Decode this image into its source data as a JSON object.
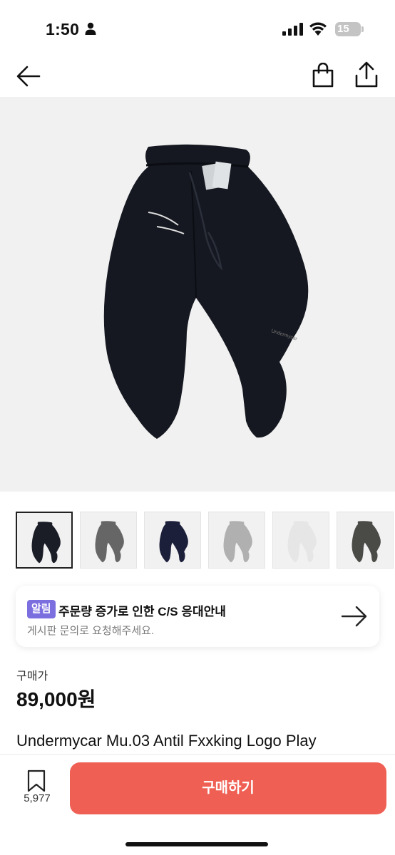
{
  "status_bar": {
    "time": "1:50",
    "battery": "15",
    "icons": [
      "person-icon",
      "signal-icon",
      "wifi-icon",
      "battery-icon"
    ]
  },
  "nav": {
    "icons": [
      "back-arrow-icon",
      "shopping-bag-icon",
      "share-icon"
    ]
  },
  "product": {
    "images": [
      {
        "color": "#1a1d26",
        "selected": true
      },
      {
        "color": "#666666",
        "selected": false
      },
      {
        "color": "#1b1f3a",
        "selected": false
      },
      {
        "color": "#b0b0b0",
        "selected": false
      },
      {
        "color": "#e6e6e6",
        "selected": false
      },
      {
        "color": "#4a4a47",
        "selected": false
      }
    ],
    "main_image_color": "#151820",
    "price_label": "구매가",
    "price": "89,000원",
    "title": "Undermycar Mu.03 Antil Fxxking Logo Play"
  },
  "notice": {
    "badge": "알림",
    "title": "주문량 증가로 인한 C/S 응대안내",
    "description": "게시판 문의로 요청해주세요."
  },
  "bottom_bar": {
    "bookmark_count": "5,977",
    "buy_label": "구매하기"
  },
  "colors": {
    "accent": "#ef5f53",
    "badge": "#7b6fe0"
  }
}
